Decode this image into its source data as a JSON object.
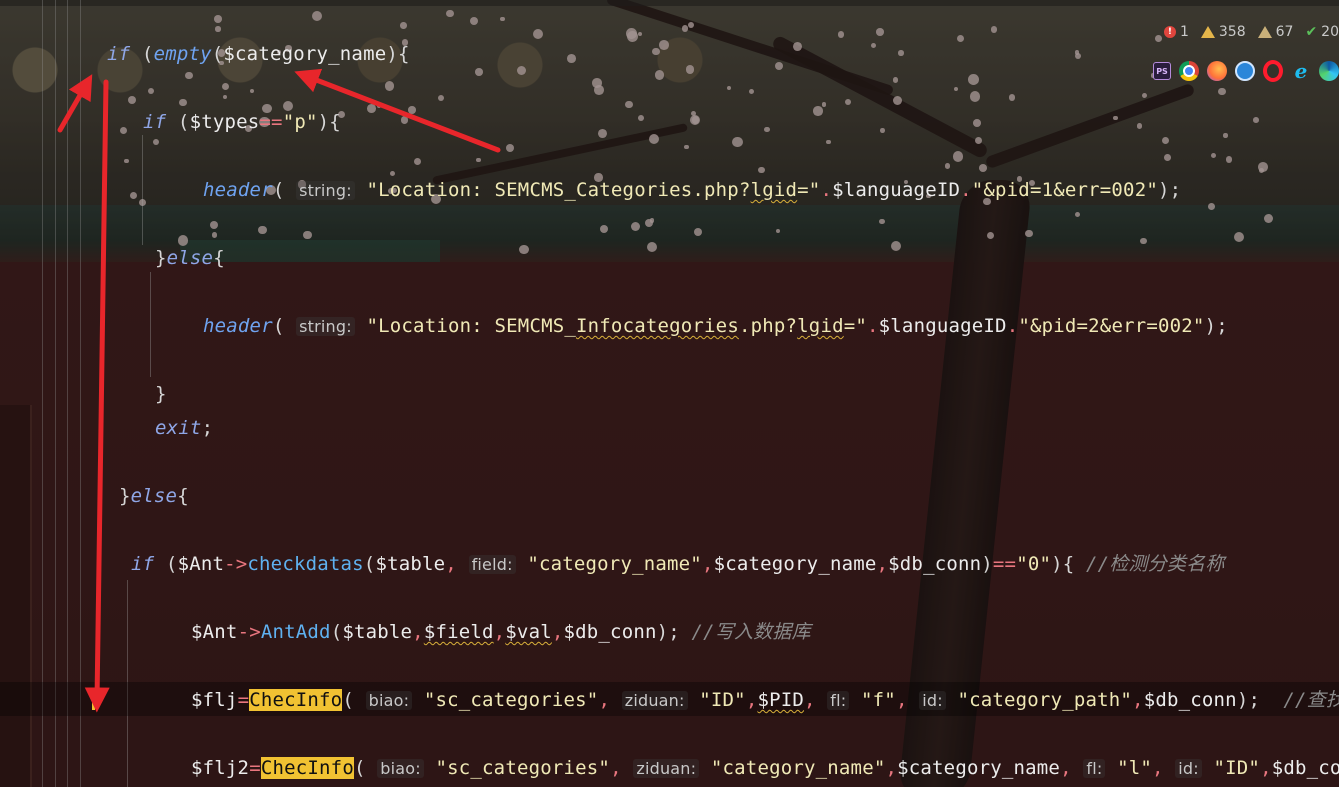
{
  "status": {
    "errors": "1",
    "warnings": "358",
    "weak_warnings": "67",
    "ok": "20"
  },
  "browsers": {
    "phpstorm_label": "PS",
    "icons": [
      "phpstorm-icon",
      "chrome-icon",
      "firefox-icon",
      "safari-icon",
      "opera-icon",
      "ie-icon",
      "edge-icon"
    ]
  },
  "code": {
    "l1": {
      "kw_if": "if",
      "fn": "empty",
      "var": "$category_name",
      "tail": "){"
    },
    "l2": {
      "kw_if": "if",
      "var": "$types",
      "op": "==",
      "str": "\"p\"",
      "tail": "){"
    },
    "l3": {
      "fn": "header",
      "hint": "string:",
      "str1": "\"Location: SEMCMS_Categories.php?",
      "sq": "lgid",
      "str2": "=\"",
      "dot1": ".",
      "var": "$languageID",
      "dot2": ".",
      "str3": "\"&pid=1&err=002\"",
      "tail": ");"
    },
    "l4": {
      "brace": "}",
      "kw": "else",
      "tail": "{"
    },
    "l5": {
      "fn": "header",
      "hint": "string:",
      "str1": "\"Location: SEMCMS_",
      "sq1": "Infocategories",
      "str1b": ".php?",
      "sq2": "lgid",
      "str2": "=\"",
      "dot1": ".",
      "var": "$languageID",
      "dot2": ".",
      "str3": "\"&pid=2&err=002\"",
      "tail": ");"
    },
    "l6": {
      "brace": "}"
    },
    "l7": {
      "kw": "exit",
      "tail": ";"
    },
    "l8": {
      "brace": "}",
      "kw": "else",
      "tail": "{"
    },
    "l9": {
      "kw_if": "if",
      "var1": "$Ant",
      "arrow": "->",
      "meth": "checkdatas",
      "var2": "$table",
      "hint": "field:",
      "str": "\"category_name\"",
      "var3": "$category_name",
      "var4": "$db_conn",
      "op": "==",
      "str2": "\"0\"",
      "tail": "){",
      "comment": "//检测分类名称"
    },
    "l10": {
      "var1": "$Ant",
      "arrow": "->",
      "meth": "AntAdd",
      "var2": "$table",
      "var3": "$field",
      "var4": "$val",
      "var5": "$db_conn",
      "tail": ");",
      "comment": "//写入数据库"
    },
    "l11": {
      "var1": "$flj",
      "op": "=",
      "fn": "ChecInfo",
      "h1": "biao:",
      "s1": "\"sc_categories\"",
      "h2": "ziduan:",
      "s2": "\"ID\"",
      "var2": "$PID",
      "h3": "fl:",
      "s3": "\"f\"",
      "h4": "id:",
      "s4": "\"category_path\"",
      "var3": "$db_conn",
      "tail": ");",
      "comment": "//查找分类"
    },
    "l12": {
      "var1": "$flj2",
      "op": "=",
      "fn": "ChecInfo",
      "h1": "biao:",
      "s1": "\"sc_categories\"",
      "h2": "ziduan:",
      "s2": "\"category_name\"",
      "var2": "$category_name",
      "h3": "fl:",
      "s3": "\"l\"",
      "h4": "id:",
      "s4": "\"ID\"",
      "var3": "$db_conn"
    }
  },
  "colors": {
    "arrow": "#e8262b",
    "highlight": "#f1c232"
  }
}
